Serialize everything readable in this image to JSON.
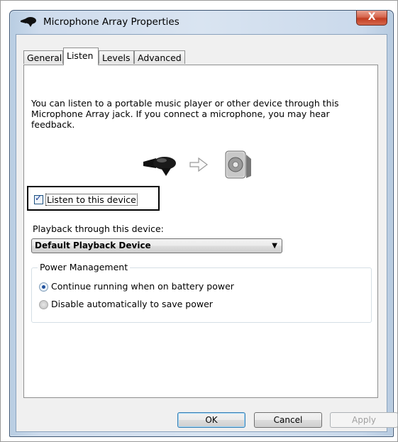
{
  "window": {
    "title": "Microphone Array Properties",
    "close_glyph": "X"
  },
  "tabs": [
    {
      "label": "General",
      "active": false
    },
    {
      "label": "Listen",
      "active": true
    },
    {
      "label": "Levels",
      "active": false
    },
    {
      "label": "Advanced",
      "active": false
    }
  ],
  "listen": {
    "description": "You can listen to a portable music player or other device through this Microphone Array jack.  If you connect a microphone, you may hear feedback.",
    "checkbox_label": "Listen to this device",
    "checkbox_checked": true,
    "playback_label": "Playback through this device:",
    "playback_value": "Default Playback Device"
  },
  "power": {
    "group_title": "Power Management",
    "options": [
      {
        "label": "Continue running when on battery power",
        "selected": true
      },
      {
        "label": "Disable automatically to save power",
        "selected": false
      }
    ]
  },
  "buttons": {
    "ok": "OK",
    "cancel": "Cancel",
    "apply": "Apply"
  },
  "icons": {
    "title": "microphone-array-icon",
    "source": "microphone-array-icon",
    "arrow": "arrow-right-icon",
    "target": "speaker-icon"
  },
  "colors": {
    "close_button": "#c23d22",
    "radio_selected": "#1e4f9d",
    "checkbox_check": "#1c3f94"
  }
}
